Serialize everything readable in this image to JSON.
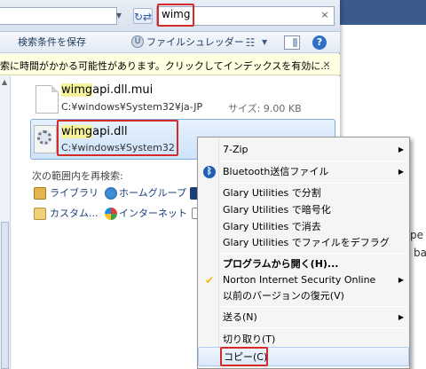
{
  "search": {
    "query": "wimg",
    "clear_glyph": "×"
  },
  "address": {
    "refresh_glyph": "↻⇄"
  },
  "toolbar": {
    "save_search": "検索条件を保存",
    "shredder": "ファイルシュレッダー",
    "view_glyph": "☷"
  },
  "infobar": {
    "text": "索に時間がかかる可能性があります。クリックしてインデックスを有効に...",
    "close_glyph": "×"
  },
  "results": [
    {
      "name_hl": "wimg",
      "name_rest": "api.dll.mui",
      "path": "C:¥windows¥System32¥ja-JP",
      "size": "サイズ: 9.00 KB"
    },
    {
      "name_hl": "wimg",
      "name_rest": "api.dll",
      "path": "C:¥windows¥System32"
    }
  ],
  "search_again": {
    "heading": "次の範囲内を再検索:",
    "items": [
      "ライブラリ",
      "ホームグループ",
      "カスタム...",
      "インターネット"
    ]
  },
  "context_menu": {
    "items": [
      {
        "label": "7-Zip",
        "submenu": true
      },
      {
        "label": "Bluetooth送信ファイル",
        "submenu": true,
        "icon": "bluetooth-icon"
      },
      {
        "label": "Glary Utilities で分割"
      },
      {
        "label": "Glary Utilities で暗号化"
      },
      {
        "label": "Glary Utilities で消去"
      },
      {
        "label": "Glary Utilities でファイルをデフラグ"
      },
      {
        "label": "プログラムから開く(H)...",
        "bold": true
      },
      {
        "label": "Norton Internet Security Online",
        "submenu": true,
        "icon": "norton-check-icon"
      },
      {
        "label": "以前のバージョンの復元(V)"
      },
      {
        "label": "送る(N)",
        "submenu": true
      },
      {
        "label": "切り取り(T)"
      },
      {
        "label": "コピー(C)"
      }
    ],
    "arrow_glyph": "▶"
  },
  "background": {
    "text_1": "pe",
    "text_2": "ba"
  },
  "colors": {
    "highlight_red": "#d42a2a",
    "selection_blue": "#cfe3fa",
    "infobar_yellow": "#ffffe1",
    "name_highlight": "#f7f39a"
  }
}
